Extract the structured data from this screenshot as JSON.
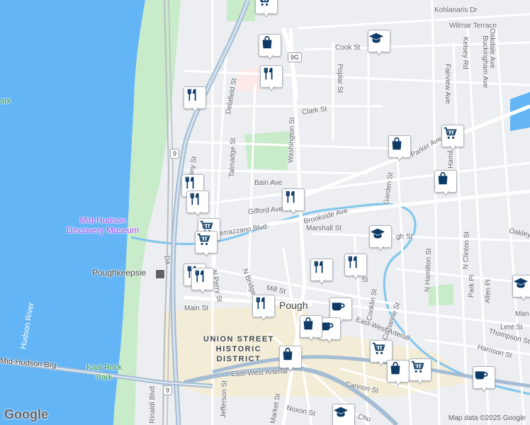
{
  "labels": {
    "streets": {
      "kohlanaris": "Kohlanaris Dr",
      "wilmar": "Wilmar Terrace",
      "cook": "Cook St",
      "oakdale": "Oakdale Ave",
      "kelsey": "Kelsey Rd",
      "buckingham": "Buckingham Ave",
      "poplar": "Poplar St",
      "fairview": "Fairview Ave",
      "clark": "Clark St",
      "delafield": "Delafield St",
      "washington": "Washington St",
      "parker": "Parker Ave",
      "talmadge": "Talmadge St",
      "hamilton_partial": "Hamil",
      "albany_partial": "Albany St",
      "bain": "Bain Ave",
      "gifford": "Gifford Ave",
      "garden": "Garden St",
      "brookside": "Brookside Ave",
      "verrazzano": "Verrazzano Blvd",
      "marshall": "Marshall St",
      "n_clinton": "N Clinton St",
      "oakley": "Oakley St",
      "n_hamilton": "N Hamilton St",
      "park_pl": "Park Pl",
      "allen_pl": "Allen Pl",
      "dutchess_partial": "Da",
      "n_perry": "N Perry St",
      "n_bridge": "N Bridge St",
      "mill": "Mill St",
      "conklin": "Conklin St",
      "catharine": "Catharine St",
      "lent": "Lent St",
      "thompson": "Thompson St",
      "harrison": "Harrison St",
      "main": "Main St",
      "east_west_arterial": "East-West Arterial",
      "east_west_arterial_2": "East-West Arterial",
      "cannon": "Cannon St",
      "noxon": "Noxon St",
      "market": "Market St",
      "jefferson": "Jefferson St",
      "rinaldi": "Rinaldi Blvd",
      "mid_hudson_brg": "Mid-Hudson Brg",
      "mansion_partial": "Man",
      "church_partial": "Chu",
      "hook_partial": "gh St",
      "st_partial": "St"
    },
    "route_9g": "9G",
    "route_9_north": "9",
    "route_9_south": "9",
    "places": {
      "museum": "Mid-Hudson\nDiscovery Museum",
      "poughkeepsie_station": "Poughkeepsie",
      "poughkeepsie_city": "Pough",
      "union_street": "UNION STREET\nHISTORIC\nDISTRICT",
      "hudson_river": "Hudson River",
      "park_partial": "ark",
      "kaal_rock": "Kaal Rock\nPark"
    }
  },
  "markers": [
    {
      "kind": "shopping-cart",
      "label": "shopping-cart-icon"
    },
    {
      "kind": "shopping-bag",
      "label": "shopping-bag-icon"
    },
    {
      "kind": "restaurant",
      "label": "restaurant-icon"
    },
    {
      "kind": "school",
      "label": "school-icon"
    },
    {
      "kind": "restaurant",
      "label": "restaurant-icon"
    },
    {
      "kind": "shopping-bag",
      "label": "shopping-bag-icon"
    },
    {
      "kind": "shopping-cart",
      "label": "shopping-cart-icon"
    },
    {
      "kind": "shopping-bag",
      "label": "shopping-bag-icon"
    },
    {
      "kind": "restaurant",
      "label": "restaurant-icon"
    },
    {
      "kind": "restaurant",
      "label": "restaurant-icon"
    },
    {
      "kind": "restaurant",
      "label": "restaurant-icon"
    },
    {
      "kind": "shopping-cart",
      "label": "shopping-cart-icon"
    },
    {
      "kind": "shopping-cart",
      "label": "shopping-cart-icon"
    },
    {
      "kind": "school",
      "label": "school-icon"
    },
    {
      "kind": "restaurant",
      "label": "restaurant-icon"
    },
    {
      "kind": "restaurant",
      "label": "restaurant-icon"
    },
    {
      "kind": "restaurant",
      "label": "restaurant-icon"
    },
    {
      "kind": "restaurant",
      "label": "restaurant-icon"
    },
    {
      "kind": "restaurant",
      "label": "restaurant-icon"
    },
    {
      "kind": "coffee",
      "label": "coffee-icon"
    },
    {
      "kind": "coffee",
      "label": "coffee-icon"
    },
    {
      "kind": "shopping-bag",
      "label": "shopping-bag-icon"
    },
    {
      "kind": "shopping-bag",
      "label": "shopping-bag-icon"
    },
    {
      "kind": "shopping-cart",
      "label": "shopping-cart-icon"
    },
    {
      "kind": "shopping-bag",
      "label": "shopping-bag-icon"
    },
    {
      "kind": "shopping-cart",
      "label": "shopping-cart-icon"
    },
    {
      "kind": "coffee",
      "label": "coffee-icon"
    },
    {
      "kind": "school",
      "label": "school-icon"
    },
    {
      "kind": "school",
      "label": "school-icon"
    }
  ],
  "footer": {
    "logo_text": "Google",
    "attribution": "Map data ©2025 Google"
  },
  "colors": {
    "water": "#64b5f6",
    "park": "#c8ebc9",
    "land": "#eceef1",
    "road": "#ffffff",
    "highway": "#a4bcd4",
    "marker_icon": "#0d3b66",
    "poi": "#a142f4"
  }
}
